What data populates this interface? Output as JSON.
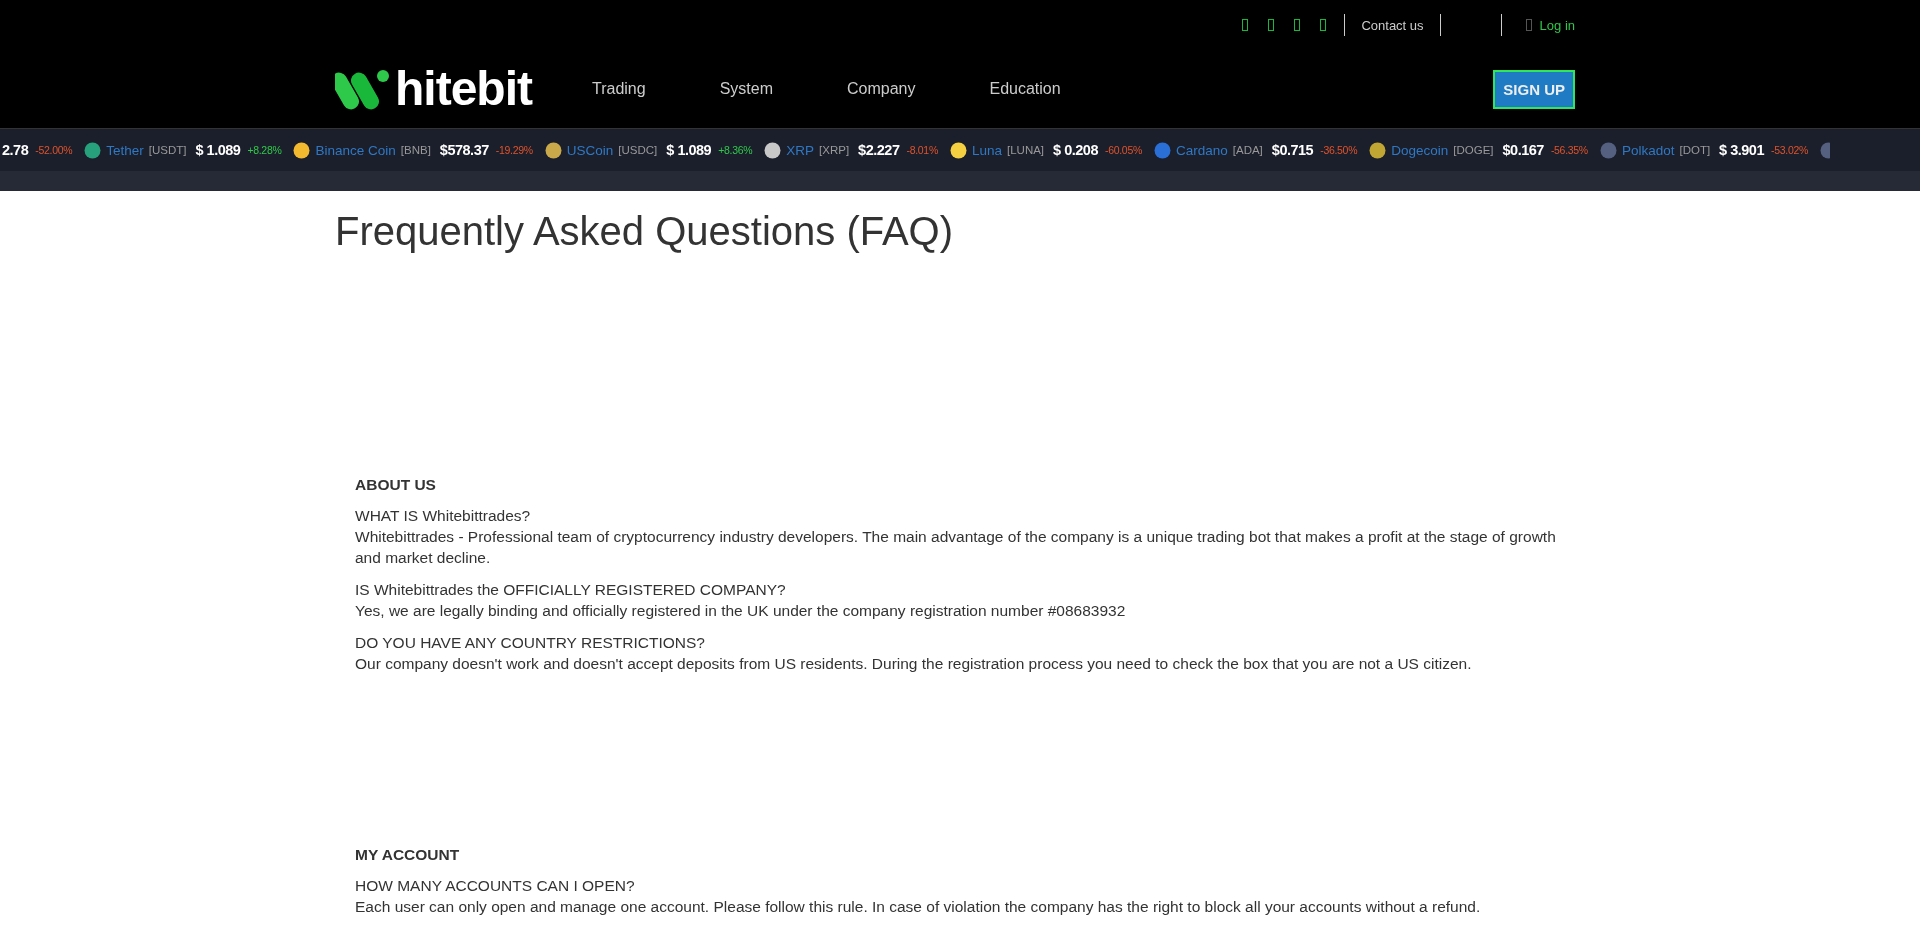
{
  "top_bar": {
    "contact": "Contact us",
    "login": "Log in"
  },
  "nav": {
    "logo": "hitebit",
    "items": [
      "Trading",
      "System",
      "Company",
      "Education"
    ],
    "signup": "SIGN UP"
  },
  "ticker": [
    {
      "price": "2.78",
      "change": "-52.00%",
      "kind": "down"
    },
    {
      "name": "Tether",
      "symbol": "[USDT]",
      "price": "$ 1.089",
      "change": "+8.28%",
      "kind": "up"
    },
    {
      "name": "Binance Coin",
      "symbol": "[BNB]",
      "price": "$578.37",
      "change": "-19.29%",
      "kind": "down"
    },
    {
      "name": "USCoin",
      "symbol": "[USDC]",
      "price": "$ 1.089",
      "change": "+8.36%",
      "kind": "up"
    },
    {
      "name": "XRP",
      "symbol": "[XRP]",
      "price": "$2.227",
      "change": "-8.01%",
      "kind": "down"
    },
    {
      "name": "Luna",
      "symbol": "[LUNA]",
      "price": "$ 0.208",
      "change": "-60.05%",
      "kind": "down"
    },
    {
      "name": "Cardano",
      "symbol": "[ADA]",
      "price": "$0.715",
      "change": "-36.50%",
      "kind": "down"
    },
    {
      "name": "Dogecoin",
      "symbol": "[DOGE]",
      "price": "$0.167",
      "change": "-56.35%",
      "kind": "down"
    },
    {
      "name": "Polkadot",
      "symbol": "[DOT]",
      "price": "$ 3.901",
      "change": "-53.02%",
      "kind": "down"
    }
  ],
  "title": "Frequently Asked Questions (FAQ)",
  "sections": [
    {
      "heading": "ABOUT US",
      "items": [
        {
          "question": "WHAT IS Whitebittrades?",
          "answer": "Whitebittrades - Professional team of cryptocurrency industry developers. The main advantage of the company is a unique trading bot that makes a profit at the stage of growth and market decline."
        },
        {
          "question": "IS Whitebittrades the OFFICIALLY REGISTERED COMPANY?",
          "answer": "Yes, we are legally binding and officially registered in the UK under the company registration number #08683932"
        },
        {
          "question": "DO YOU HAVE ANY COUNTRY RESTRICTIONS?",
          "answer": "Our company doesn't work and doesn't accept deposits from US residents. During the registration process you need to check the box that you are not a US citizen."
        }
      ]
    },
    {
      "heading": "MY ACCOUNT",
      "items": [
        {
          "question": "HOW MANY ACCOUNTS CAN I OPEN?",
          "answer": "Each user can only open and manage one account. Please follow this rule. In case of violation the company has the right to block all your accounts without a refund."
        }
      ]
    }
  ]
}
